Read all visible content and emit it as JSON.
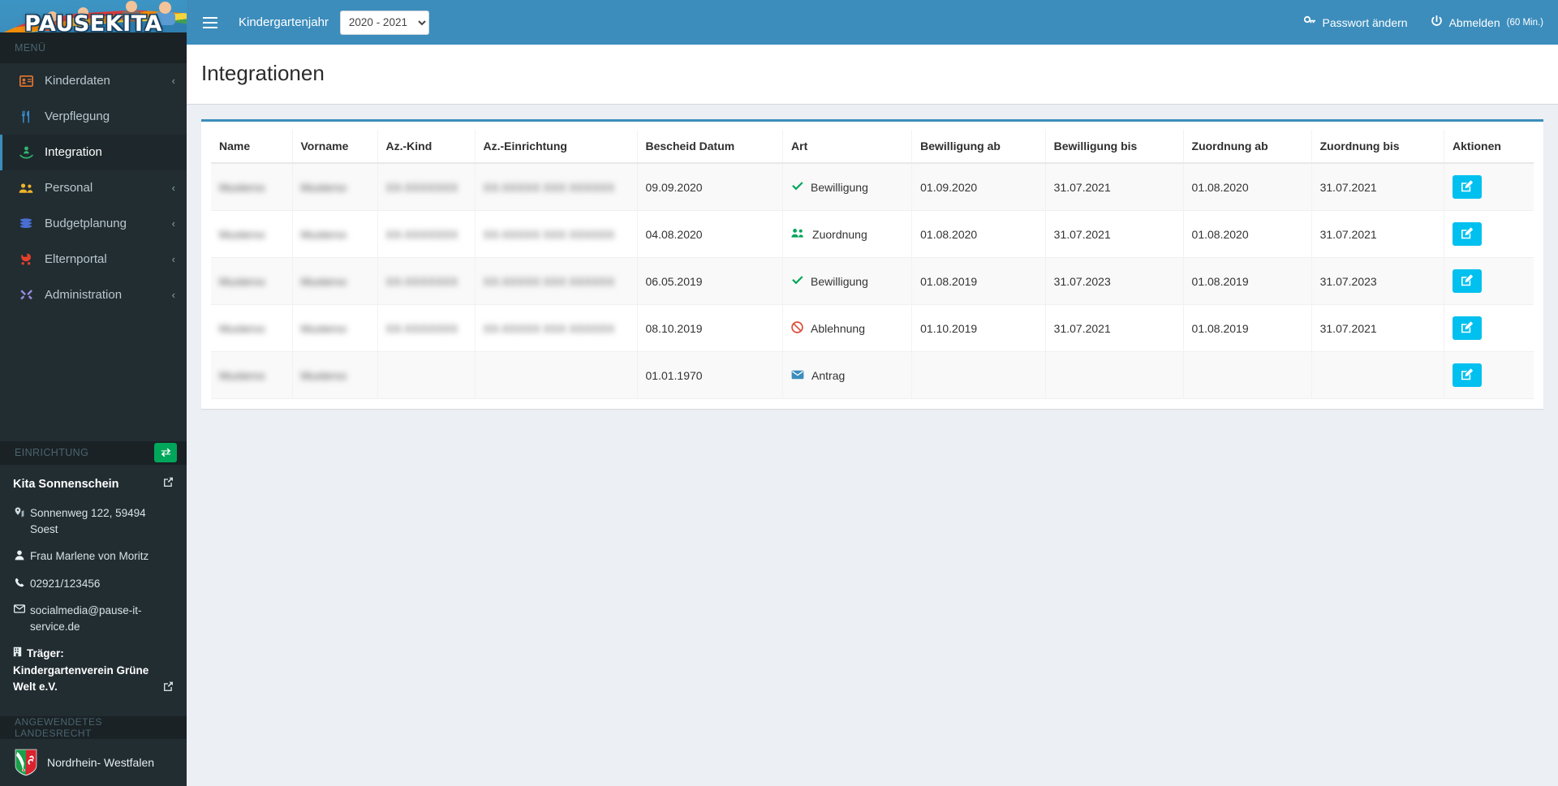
{
  "brand": {
    "logo_text": "PAUSEKITA"
  },
  "sidebar": {
    "menu_heading": "MENÜ",
    "items": [
      {
        "label": "Kinderdaten",
        "icon": "id-card-icon",
        "chevron": "‹",
        "active": false
      },
      {
        "label": "Verpflegung",
        "icon": "cutlery-icon",
        "chevron": "",
        "active": false
      },
      {
        "label": "Integration",
        "icon": "hand-holding-person-icon",
        "chevron": "",
        "active": true
      },
      {
        "label": "Personal",
        "icon": "users-icon",
        "chevron": "‹",
        "active": false
      },
      {
        "label": "Budgetplanung",
        "icon": "coins-icon",
        "chevron": "‹",
        "active": false
      },
      {
        "label": "Elternportal",
        "icon": "stroller-icon",
        "chevron": "‹",
        "active": false
      },
      {
        "label": "Administration",
        "icon": "tools-icon",
        "chevron": "‹",
        "active": false
      }
    ],
    "einrichtung": {
      "heading": "EINRICHTUNG",
      "swap_title": "Einrichtung wechseln",
      "name": "Kita Sonnenschein",
      "address": "Sonnenweg 122, 59494 Soest",
      "contact_person": "Frau Marlene von Moritz",
      "phone": "02921/123456",
      "email": "socialmedia@pause-it-service.de",
      "traeger_label": "Träger:",
      "traeger_name": "Kindergartenverein Grüne Welt e.V."
    },
    "landesrecht": {
      "heading": "ANGEWENDETES LANDESRECHT",
      "name": "Nordrhein- Westfalen"
    }
  },
  "topbar": {
    "menu_toggle": "toggle-sidebar",
    "kindergartenjahr_label": "Kindergartenjahr",
    "year_selected": "2020 - 2021",
    "year_options": [
      "2020 - 2021"
    ],
    "password_change": "Passwort ändern",
    "logout": "Abmelden",
    "logout_timer": "(60 Min.)"
  },
  "page": {
    "title": "Integrationen"
  },
  "table": {
    "columns": [
      "Name",
      "Vorname",
      "Az.-Kind",
      "Az.-Einrichtung",
      "Bescheid Datum",
      "Art",
      "Bewilligung ab",
      "Bewilligung bis",
      "Zuordnung ab",
      "Zuordnung bis",
      "Aktionen"
    ],
    "rows": [
      {
        "name": "redacted",
        "vorname": "redacted",
        "az_kind": "redacted",
        "az_einrichtung": "redacted",
        "bescheid_datum": "09.09.2020",
        "art": "Bewilligung",
        "art_icon": "check-icon",
        "art_color": "#00a65a",
        "bewilligung_ab": "01.09.2020",
        "bewilligung_bis": "31.07.2021",
        "zuordnung_ab": "01.08.2020",
        "zuordnung_bis": "31.07.2021",
        "action": "edit-button"
      },
      {
        "name": "redacted",
        "vorname": "redacted",
        "az_kind": "redacted",
        "az_einrichtung": "redacted",
        "bescheid_datum": "04.08.2020",
        "art": "Zuordnung",
        "art_icon": "users-icon",
        "art_color": "#00a65a",
        "bewilligung_ab": "01.08.2020",
        "bewilligung_bis": "31.07.2021",
        "zuordnung_ab": "01.08.2020",
        "zuordnung_bis": "31.07.2021",
        "action": "edit-button"
      },
      {
        "name": "redacted",
        "vorname": "redacted",
        "az_kind": "redacted",
        "az_einrichtung": "redacted",
        "bescheid_datum": "06.05.2019",
        "art": "Bewilligung",
        "art_icon": "check-icon",
        "art_color": "#00a65a",
        "bewilligung_ab": "01.08.2019",
        "bewilligung_bis": "31.07.2023",
        "zuordnung_ab": "01.08.2019",
        "zuordnung_bis": "31.07.2023",
        "action": "edit-button"
      },
      {
        "name": "redacted",
        "vorname": "redacted",
        "az_kind": "redacted",
        "az_einrichtung": "redacted",
        "bescheid_datum": "08.10.2019",
        "art": "Ablehnung",
        "art_icon": "ban-icon",
        "art_color": "#dd4b39",
        "bewilligung_ab": "01.10.2019",
        "bewilligung_bis": "31.07.2021",
        "zuordnung_ab": "01.08.2019",
        "zuordnung_bis": "31.07.2021",
        "action": "edit-button"
      },
      {
        "name": "redacted",
        "vorname": "redacted",
        "az_kind": "",
        "az_einrichtung": "",
        "bescheid_datum": "01.01.1970",
        "art": "Antrag",
        "art_icon": "envelope-icon",
        "art_color": "#3c8dbc",
        "bewilligung_ab": "",
        "bewilligung_bis": "",
        "zuordnung_ab": "",
        "zuordnung_bis": "",
        "action": "edit-button"
      }
    ]
  },
  "colors": {
    "header_blue": "#3c8dbc",
    "sidebar_dark": "#222d32",
    "action_cyan": "#00c0ef",
    "success_green": "#00a65a",
    "danger_red": "#dd4b39"
  }
}
